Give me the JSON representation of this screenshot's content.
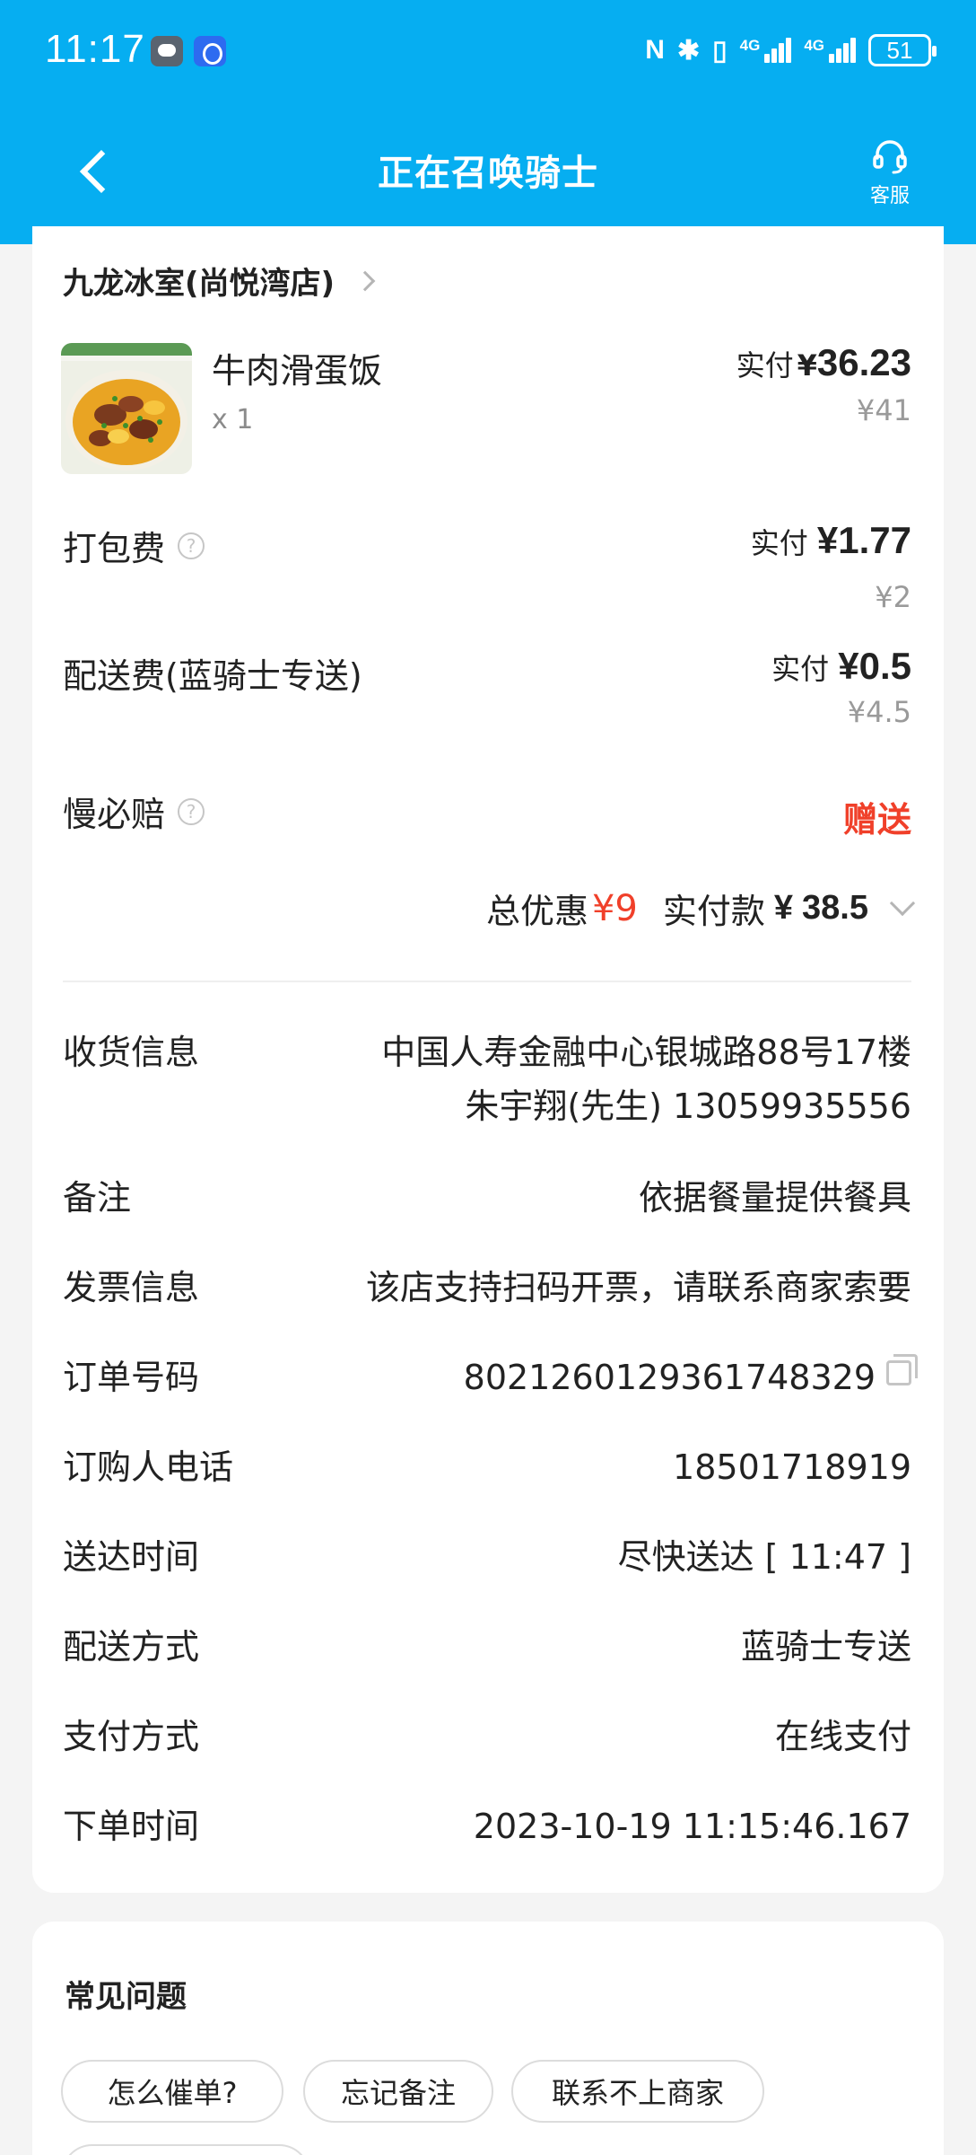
{
  "status_bar": {
    "time": "11:17",
    "network_1": "4G",
    "network_2": "4G",
    "battery": "51"
  },
  "header": {
    "title": "正在召唤骑士",
    "service_label": "客服",
    "bg_color": "#06aef1"
  },
  "store": {
    "name": "九龙冰室(尚悦湾店)"
  },
  "item": {
    "name": "牛肉滑蛋饭",
    "qty": "x 1",
    "paid_label": "实付",
    "currency": "¥",
    "paid": "36.23",
    "original": "¥41"
  },
  "fees": {
    "packing": {
      "label": "打包费",
      "paid_label": "实付",
      "paid": "¥1.77",
      "original": "¥2"
    },
    "delivery": {
      "label": "配送费(蓝骑士专送)",
      "paid_label": "实付",
      "paid": "¥0.5",
      "original": "¥4.5"
    },
    "late": {
      "label": "慢必赔",
      "value": "赠送"
    }
  },
  "summary": {
    "discount_label": "总优惠",
    "discount": "¥9",
    "total_label": "实付款",
    "currency": "¥",
    "total": "38.5"
  },
  "info": {
    "receiver": {
      "label": "收货信息",
      "address": "中国人寿金融中心银城路88号17楼",
      "contact": "朱宇翔(先生) 13059935556"
    },
    "note": {
      "label": "备注",
      "value": "依据餐量提供餐具"
    },
    "invoice": {
      "label": "发票信息",
      "value": "该店支持扫码开票，请联系商家索要"
    },
    "order_no": {
      "label": "订单号码",
      "value": "8021260129361748329"
    },
    "phone": {
      "label": "订购人电话",
      "value": "18501718919"
    },
    "delivery_time": {
      "label": "送达时间",
      "value": "尽快送达 [ 11:47 ]"
    },
    "delivery_method": {
      "label": "配送方式",
      "value": "蓝骑士专送"
    },
    "payment": {
      "label": "支付方式",
      "value": "在线支付"
    },
    "order_time": {
      "label": "下单时间",
      "value": "2023-10-19 11:15:46.167"
    }
  },
  "faq": {
    "title": "常见问题",
    "chips": [
      "怎么催单?",
      "忘记备注",
      "联系不上商家"
    ]
  }
}
